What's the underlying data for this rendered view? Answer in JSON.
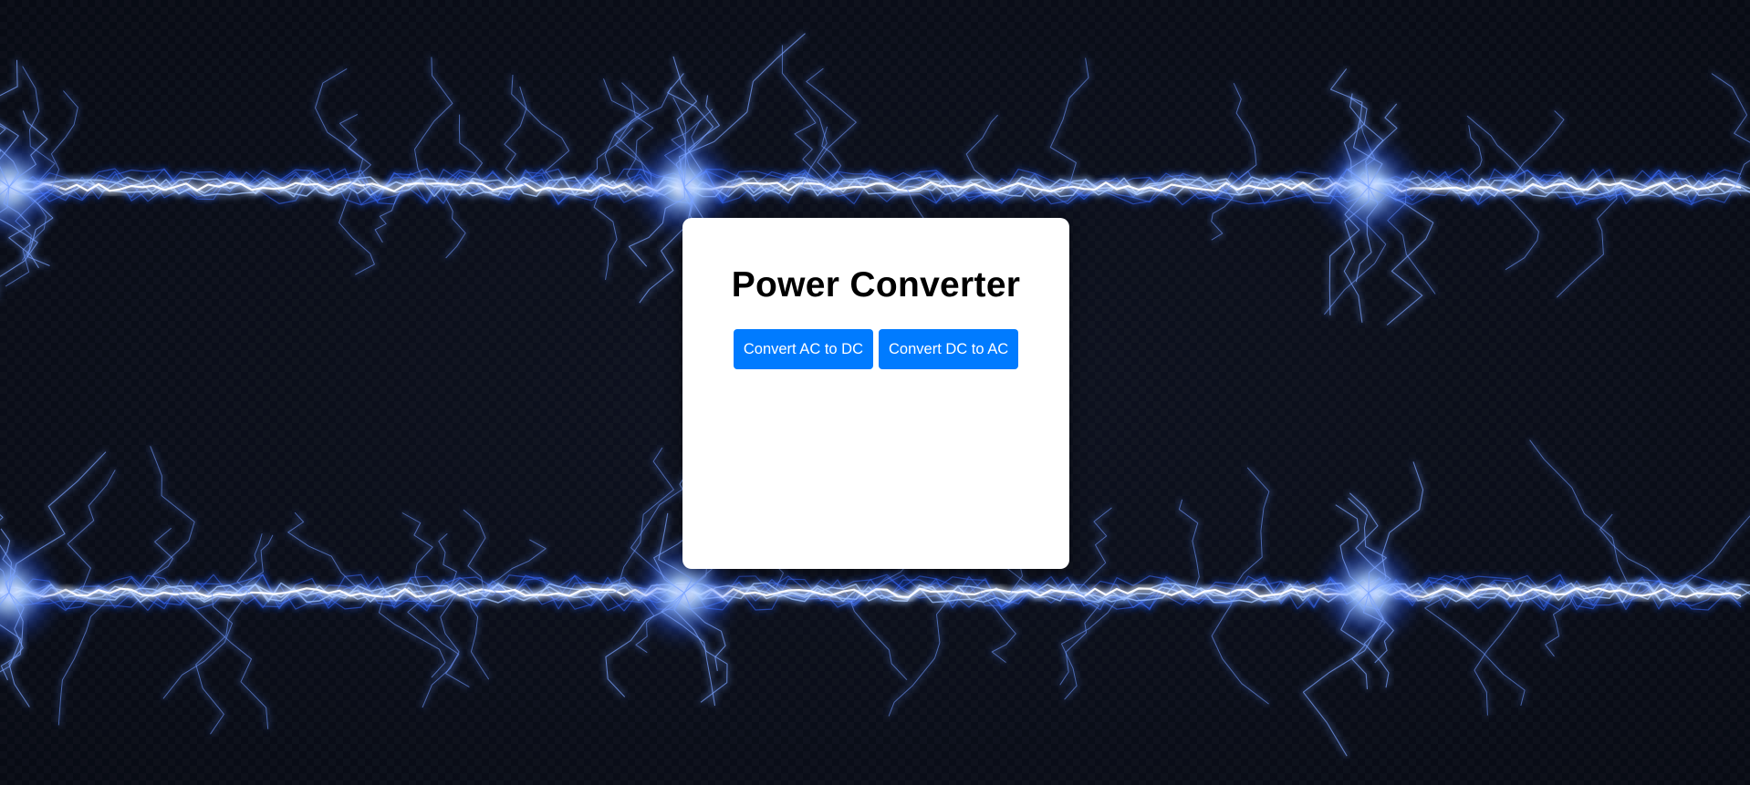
{
  "page": {
    "background_color": "#0a0d17",
    "decoration": "lightning-bolts"
  },
  "card": {
    "title": "Power Converter",
    "buttons": {
      "ac_to_dc": "Convert AC to DC",
      "dc_to_ac": "Convert DC to AC"
    },
    "button_color": "#007bff"
  }
}
